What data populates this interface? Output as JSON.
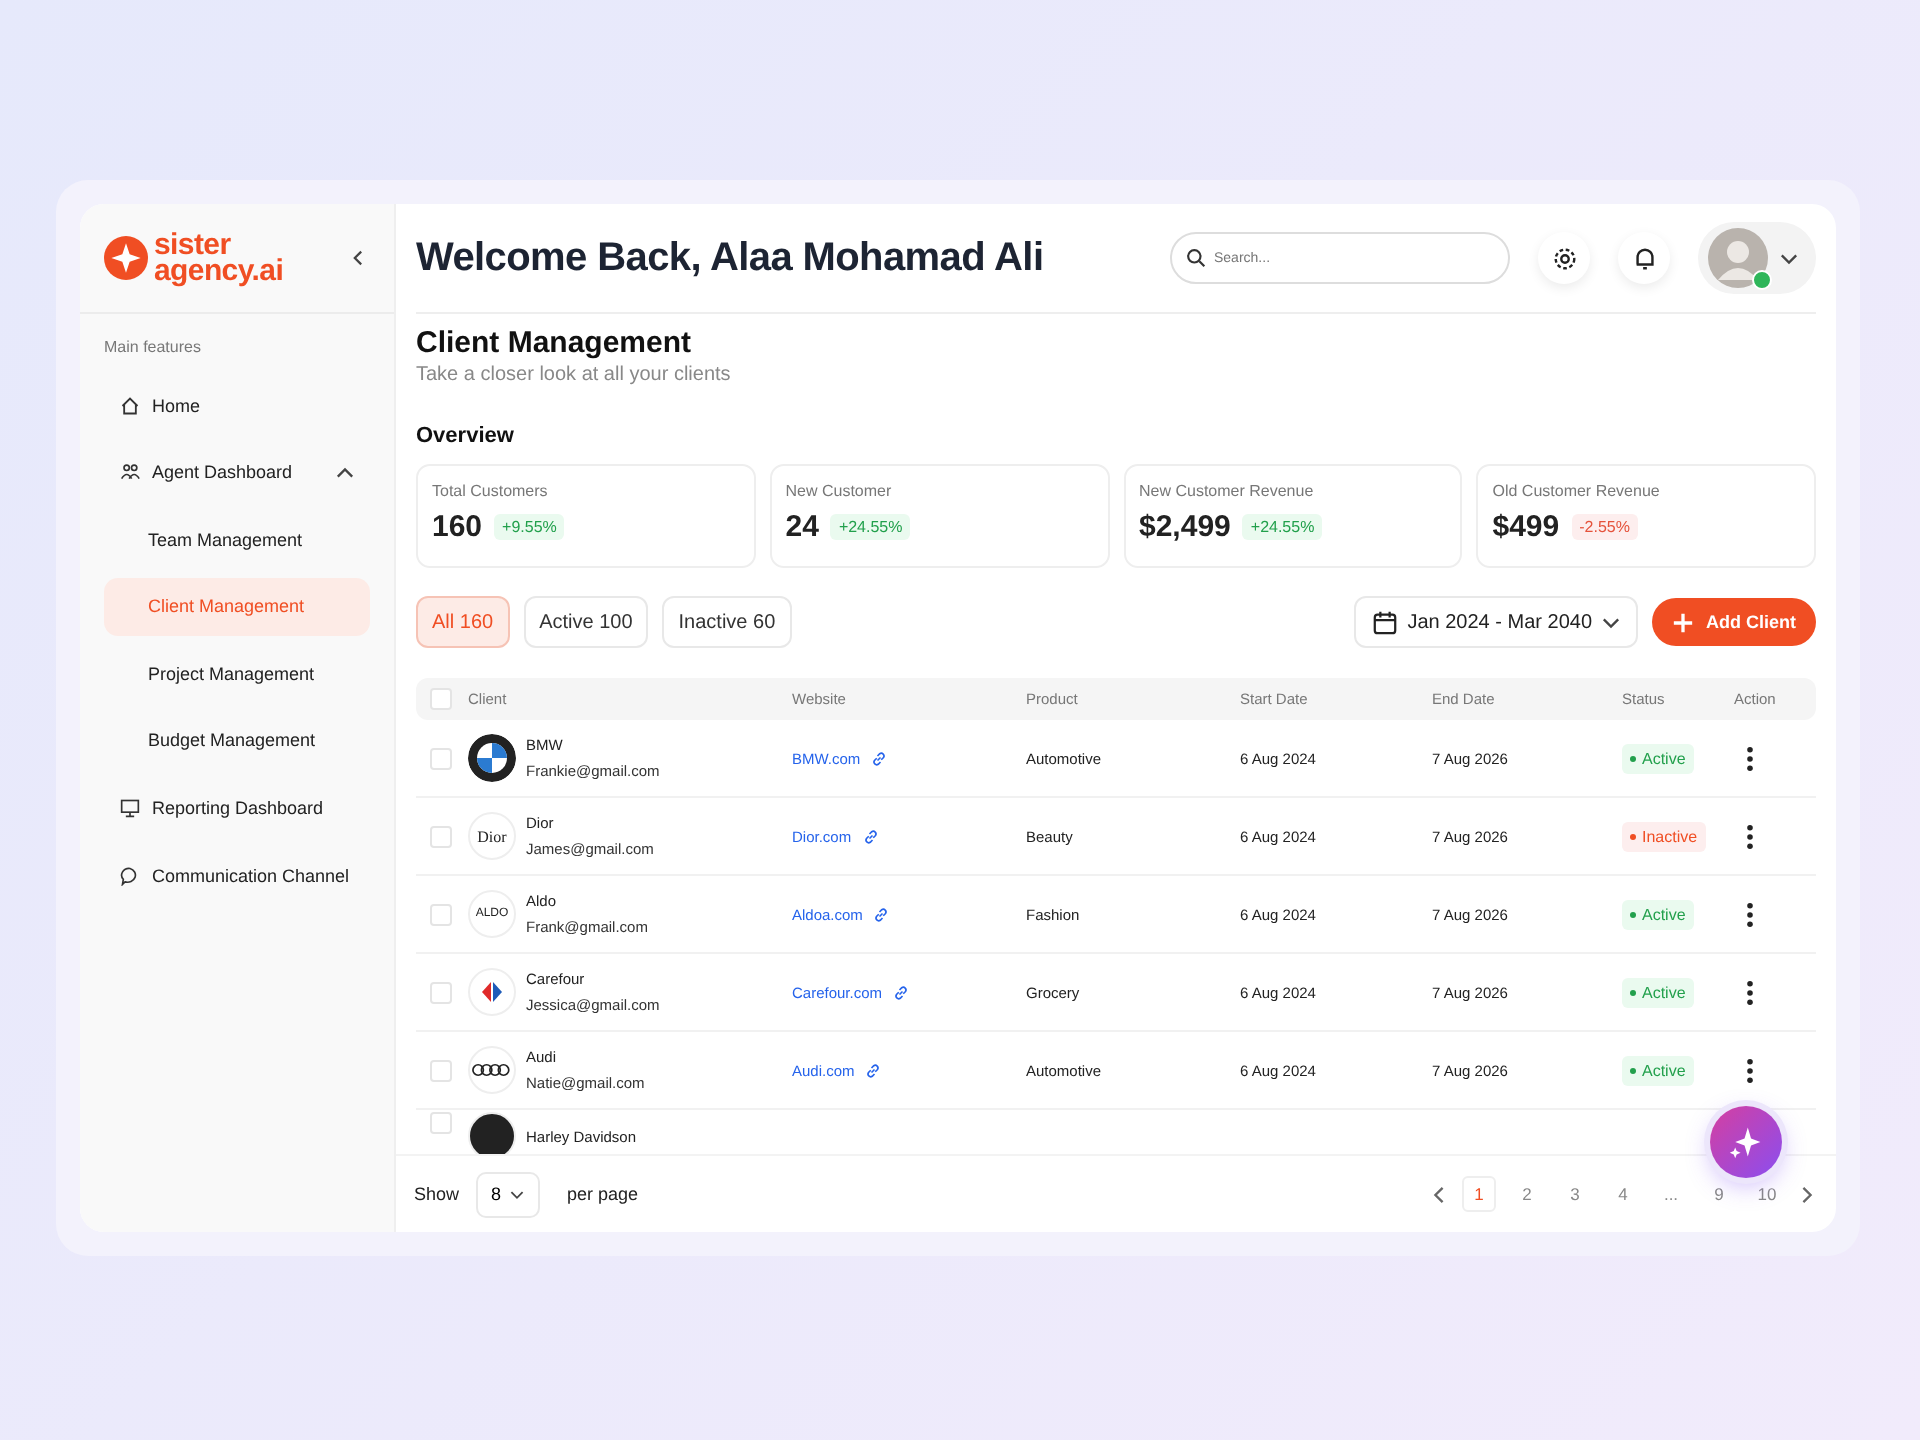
{
  "logo": {
    "line_1": "sister",
    "line_2": "agency.ai"
  },
  "sidebar": {
    "section_label": "Main features",
    "items": [
      {
        "label": "Home",
        "selected": false
      },
      {
        "label": "Agent Dashboard",
        "selected": false,
        "expanded": true,
        "children": [
          {
            "label": "Team Management",
            "selected": false
          },
          {
            "label": "Client Management",
            "selected": true
          },
          {
            "label": "Project Management",
            "selected": false
          },
          {
            "label": "Budget Management",
            "selected": false
          }
        ]
      },
      {
        "label": "Reporting Dashboard",
        "selected": false
      },
      {
        "label": "Communication Channel",
        "selected": false
      }
    ]
  },
  "header": {
    "greeting": "Welcome Back, Alaa Mohamad Ali",
    "search": {
      "placeholder": "Search..."
    },
    "user_online": true
  },
  "page": {
    "title": "Client Management",
    "subtitle": "Take a closer look at all your clients",
    "overview_title": "Overview"
  },
  "stats": [
    {
      "label": "Total Customers",
      "value": "160",
      "change": "+9.55%",
      "kind": "up"
    },
    {
      "label": "New Customer",
      "value": "24",
      "change": "+24.55%",
      "kind": "up"
    },
    {
      "label": "New Customer Revenue",
      "value": "$2,499",
      "change": "+24.55%",
      "kind": "up"
    },
    {
      "label": "Old Customer Revenue",
      "value": "$499",
      "change": "-2.55%",
      "kind": "down"
    }
  ],
  "filters": [
    {
      "label": "All 160",
      "selected": true
    },
    {
      "label": "Active 100",
      "selected": false
    },
    {
      "label": "Inactive 60",
      "selected": false
    }
  ],
  "date_range": "Jan 2024 - Mar 2040",
  "add_button": "Add Client",
  "table": {
    "columns": [
      "Client",
      "Website",
      "Product",
      "Start Date",
      "End Date",
      "Status",
      "Action"
    ],
    "all_checked": false,
    "rows": [
      {
        "name": "BMW",
        "email": "Frankie@gmail.com",
        "logo": {
          "kind": "roundel"
        },
        "website": "BMW.com",
        "product": "Automotive",
        "start": "6 Aug 2024",
        "end": "7 Aug 2026",
        "status": {
          "label": "Active",
          "kind": "active"
        },
        "checked": false
      },
      {
        "name": "Dior",
        "email": "James@gmail.com",
        "logo": {
          "kind": "serif",
          "text": "Dior"
        },
        "website": "Dior.com",
        "product": "Beauty",
        "start": "6 Aug 2024",
        "end": "7 Aug 2026",
        "status": {
          "label": "Inactive",
          "kind": "inactive"
        },
        "checked": false
      },
      {
        "name": "Aldo",
        "email": "Frank@gmail.com",
        "logo": {
          "kind": "sans",
          "text": "ALDO"
        },
        "website": "Aldoa.com",
        "product": "Fashion",
        "start": "6 Aug 2024",
        "end": "7 Aug 2026",
        "status": {
          "label": "Active",
          "kind": "active"
        },
        "checked": false
      },
      {
        "name": "Carefour",
        "email": "Jessica@gmail.com",
        "logo": {
          "kind": "mark"
        },
        "website": "Carefour.com",
        "product": "Grocery",
        "start": "6 Aug 2024",
        "end": "7 Aug 2026",
        "status": {
          "label": "Active",
          "kind": "active"
        },
        "checked": false
      },
      {
        "name": "Audi",
        "email": "Natie@gmail.com",
        "logo": {
          "kind": "rings"
        },
        "website": "Audi.com",
        "product": "Automotive",
        "start": "6 Aug 2024",
        "end": "7 Aug 2026",
        "status": {
          "label": "Active",
          "kind": "active"
        },
        "checked": false
      },
      {
        "name": "Harley Davidson",
        "logo": {
          "kind": "dark"
        },
        "checked": false
      }
    ]
  },
  "footer": {
    "show_label": "Show",
    "per_page_value": "8",
    "per_page_label": "per page",
    "pages": [
      {
        "label": "1",
        "selected": true
      },
      {
        "label": "2",
        "selected": false
      },
      {
        "label": "3",
        "selected": false
      },
      {
        "label": "4",
        "selected": false
      },
      {
        "label": "...",
        "selected": false
      },
      {
        "label": "9",
        "selected": false
      },
      {
        "label": "10",
        "selected": false
      }
    ]
  }
}
